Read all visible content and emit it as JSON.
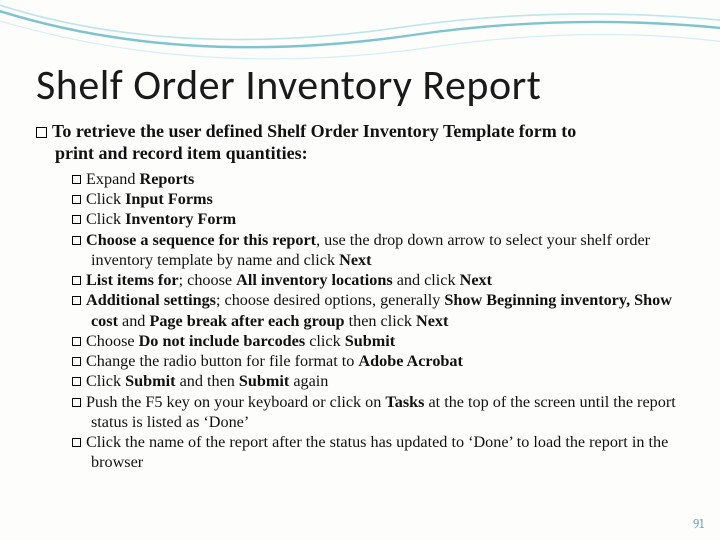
{
  "title": "Shelf Order Inventory Report",
  "lead": {
    "prefix": "To retrieve the user defined Shelf Order Inventory Template form to",
    "cont": "print and record item quantities:"
  },
  "items": [
    {
      "plain": "Expand ",
      "bold": "Reports"
    },
    {
      "plain": "Click ",
      "bold": "Input Forms"
    },
    {
      "plain": "Click ",
      "bold": "Inventory Form"
    },
    {
      "html": "<span class=\"b\">Choose a sequence for this report</span>, use the drop down arrow to select your shelf order inventory template by name and click <span class=\"b\">Next</span>"
    },
    {
      "html": "<span class=\"b\">List items for</span>; choose <span class=\"b\">All inventory locations</span> and click  <span class=\"b\">Next</span>"
    },
    {
      "html": "<span class=\"b\">Additional settings</span>; choose desired options, generally <span class=\"b\">Show Beginning inventory, Show cost</span> and <span class=\"b\">Page break after each group</span> then click <span class=\"b\">Next</span>"
    },
    {
      "html": "Choose <span class=\"b\">Do not include barcodes</span> click <span class=\"b\">Submit</span>"
    },
    {
      "html": "Change the radio button for file format to <span class=\"b\">Adobe Acrobat</span>"
    },
    {
      "html": "Click  <span class=\"b\">Submit</span> and then <span class=\"b\">Submit</span> again"
    },
    {
      "html": "Push the F5 key on your keyboard or click on <span class=\"b\">Tasks</span> at the top of the screen until the report status is listed as ‘Done’"
    },
    {
      "html": "Click the name of the report after the status has updated to ‘Done’ to load the report in the browser"
    }
  ],
  "pagenum": "91"
}
